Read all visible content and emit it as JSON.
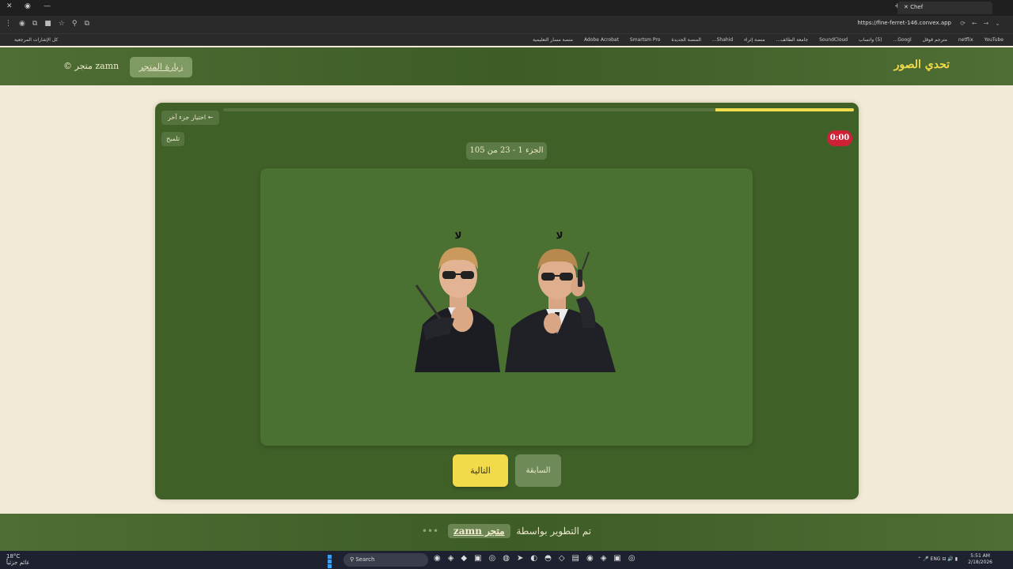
{
  "browser": {
    "tab_title": "Chef",
    "url": "https://fine-ferret-146.convex.app",
    "bookmarks": [
      "YouTube",
      "netflix",
      "مترجم قوقل",
      "Googl...",
      "(5) واتساب",
      "SoundCloud",
      "جامعة الطائف...",
      "منصة إثراء",
      "Shahid...",
      "المنصة الجديدة",
      "Smartsm Pro",
      "Adobe Acrobat",
      "منصة مسار التعليمية"
    ],
    "all_bookmarks_label": "كل الإشارات المرجعية"
  },
  "header": {
    "brand_title": "تحدي الصور",
    "visit_store_label": "زيارة المتجر",
    "copyright": "© متجر zamn"
  },
  "quiz": {
    "change_part_label": "← اختيار جزء آخر",
    "hint_label": "تلميح",
    "timer": "0:00",
    "part_indicator": "الجزء 1 - 23 من 105",
    "progress_fraction": 0.22,
    "figure_labels": [
      "لا",
      "لا"
    ],
    "next_label": "التالية",
    "prev_label": "السابقة"
  },
  "footer": {
    "developed_by": "تم التطوير بواسطة",
    "store_link": "متجر zamn",
    "dots": "•••"
  },
  "taskbar": {
    "weather_temp": "18°C",
    "weather_desc": "غائم جزئياً",
    "search_placeholder": "Search",
    "lang": "ENG",
    "time": "5:51 AM",
    "date": "2/18/2026"
  },
  "colors": {
    "header_green": "#3d5c26",
    "card_green": "#3f6128",
    "accent_yellow": "#f2da4a",
    "timer_red": "#cf2136",
    "page_bg": "#f1ead6"
  }
}
